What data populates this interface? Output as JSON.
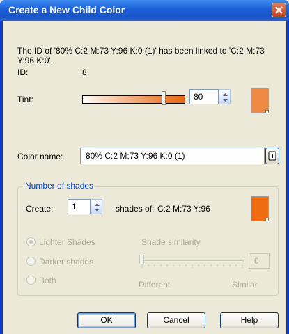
{
  "window": {
    "title": "Create a New Child Color"
  },
  "link_message": "The ID of '80% C:2 M:73 Y:96 K:0 (1)' has been linked to 'C:2 M:73 Y:96 K:0'.",
  "id": {
    "label": "ID:",
    "value": "8"
  },
  "tint": {
    "label": "Tint:",
    "value": "80",
    "level_percent": 80,
    "swatch_color": "#ef8a44"
  },
  "color_name": {
    "label": "Color name:",
    "value": "80% C:2 M:73 Y:96 K:0 (1)"
  },
  "shades": {
    "group_label": "Number of shades",
    "create_label": "Create:",
    "create_value": "1",
    "shades_of_label": "shades of:",
    "base_color": "C:2 M:73 Y:96",
    "swatch_color": "#ef6d10",
    "options": {
      "lighter": "Lighter Shades",
      "darker": "Darker shades",
      "both": "Both"
    },
    "selected_option": "Lighter Shades",
    "similarity": {
      "label": "Shade similarity",
      "value": "0",
      "min_label": "Different",
      "max_label": "Similar"
    }
  },
  "buttons": {
    "ok": "OK",
    "cancel": "Cancel",
    "help": "Help"
  },
  "colors": {
    "titlebar": "#1c5fd8",
    "dialog_bg": "#ece9d8",
    "accent_text": "#0046d5"
  }
}
